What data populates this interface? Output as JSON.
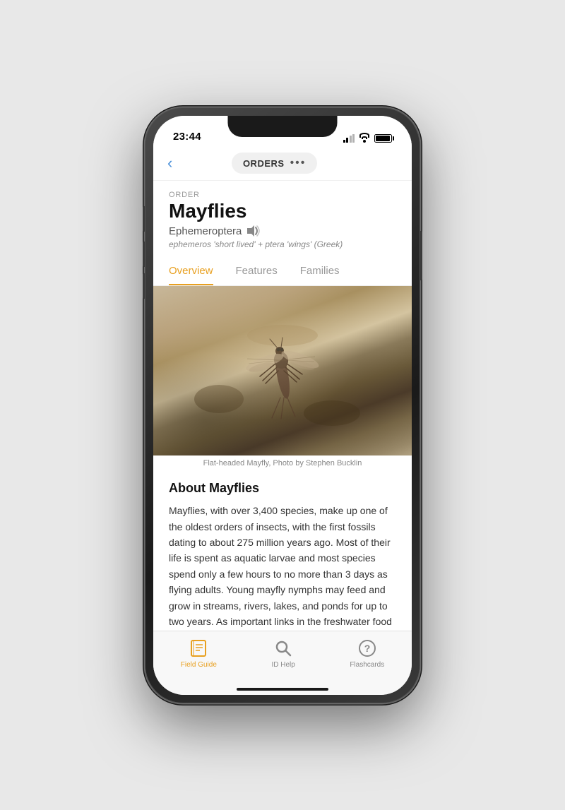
{
  "phone": {
    "status_bar": {
      "time": "23:44"
    },
    "nav": {
      "title": "ORDERS",
      "dots": "•••"
    },
    "header": {
      "order_label": "ORDER",
      "name": "Mayflies",
      "scientific": "Ephemeroptera",
      "etymology": "ephemeros 'short lived' + ptera 'wings' (Greek)"
    },
    "tabs": [
      {
        "label": "Overview",
        "active": true
      },
      {
        "label": "Features",
        "active": false
      },
      {
        "label": "Families",
        "active": false
      }
    ],
    "image": {
      "caption": "Flat-headed Mayfly, Photo by Stephen Bucklin"
    },
    "about": {
      "title": "About Mayflies",
      "text": "Mayflies, with over 3,400 species, make up one of the oldest orders of insects, with the first fossils dating to about 275 million years ago. Most of their life is spent as aquatic larvae and most species spend only a few hours to no more than 3 days as flying adults. Young mayfly nymphs may feed and grow in streams, rivers, lakes, and ponds for up to two years. As important links in the freshwater food web, young mayflies are often voracious herbivores, detritivores, or even carnivores, in addition to being"
    },
    "bottom_tabs": [
      {
        "label": "Field Guide",
        "active": true,
        "icon": "book-icon"
      },
      {
        "label": "ID Help",
        "active": false,
        "icon": "search-icon"
      },
      {
        "label": "Flashcards",
        "active": false,
        "icon": "flashcard-icon"
      }
    ]
  }
}
